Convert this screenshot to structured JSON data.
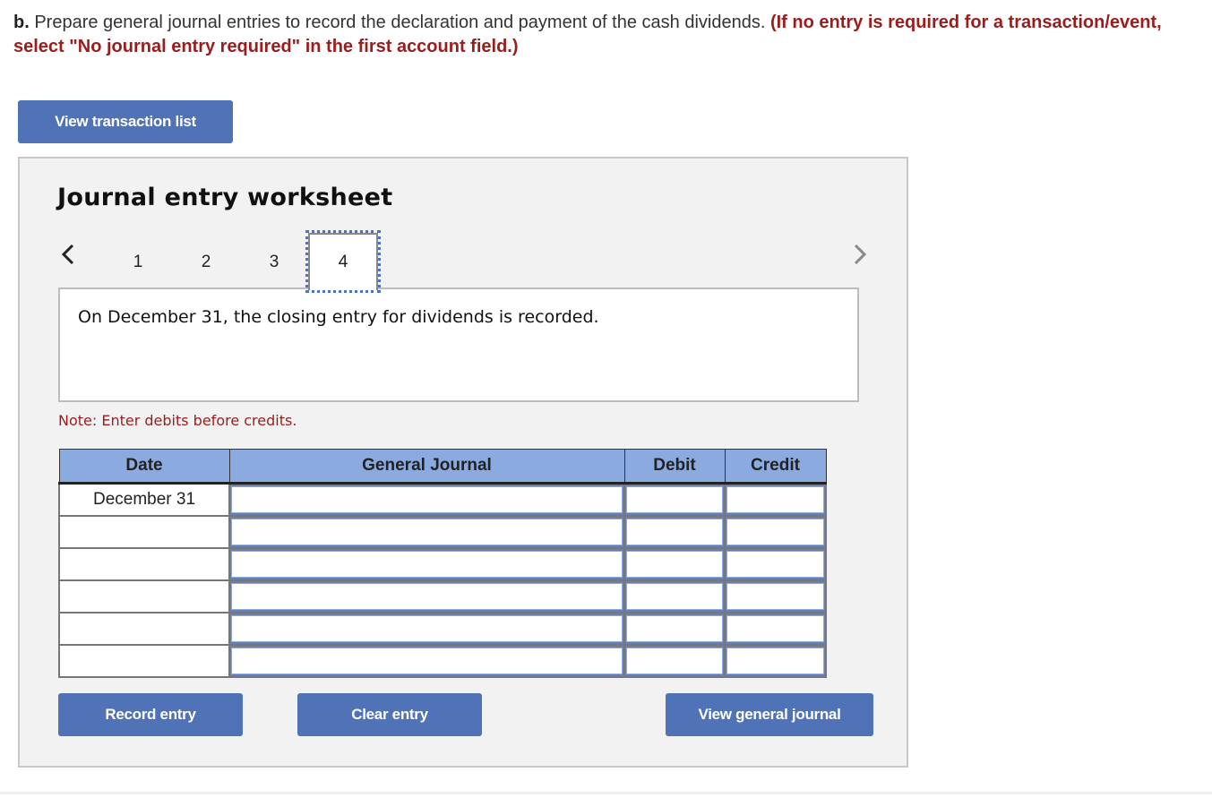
{
  "instructions": {
    "lead": "b.",
    "text": " Prepare general journal entries to record the declaration and payment of the cash dividends. ",
    "emphasis": "(If no entry is required for a transaction/event, select \"No journal entry required\" in the first account field.)"
  },
  "buttons": {
    "view_transaction_list": "View transaction list",
    "record_entry": "Record entry",
    "clear_entry": "Clear entry",
    "view_general_journal": "View general journal"
  },
  "worksheet": {
    "title": "Journal entry worksheet",
    "steps": [
      "1",
      "2",
      "3",
      "4"
    ],
    "active_step": "4",
    "description": "On December 31, the closing entry for dividends is recorded.",
    "note": "Note: Enter debits before credits."
  },
  "table": {
    "headers": [
      "Date",
      "General Journal",
      "Debit",
      "Credit"
    ],
    "rows": [
      {
        "date": "December 31",
        "account": "",
        "debit": "",
        "credit": ""
      },
      {
        "date": "",
        "account": "",
        "debit": "",
        "credit": ""
      },
      {
        "date": "",
        "account": "",
        "debit": "",
        "credit": ""
      },
      {
        "date": "",
        "account": "",
        "debit": "",
        "credit": ""
      },
      {
        "date": "",
        "account": "",
        "debit": "",
        "credit": ""
      },
      {
        "date": "",
        "account": "",
        "debit": "",
        "credit": ""
      }
    ]
  },
  "colors": {
    "button": "#5072b6",
    "header": "#8aaae0",
    "emphasis_red": "#9b1c1c"
  }
}
